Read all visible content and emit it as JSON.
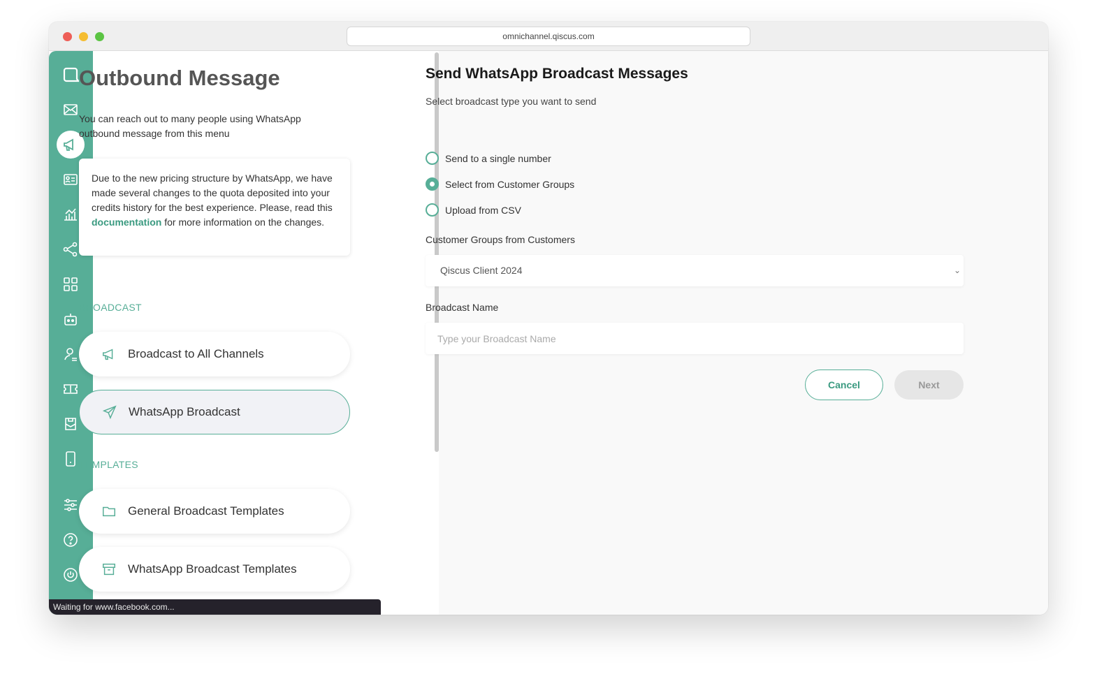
{
  "browser": {
    "url": "omnichannel.qiscus.com"
  },
  "rail": {
    "icons": [
      "chat-bubble-icon",
      "mail-icon",
      "megaphone-icon",
      "contact-card-icon",
      "analytics-chart-icon",
      "share-nodes-icon",
      "apps-grid-icon",
      "bot-icon",
      "agent-icon",
      "ticket-icon",
      "inbox-icon",
      "mobile-icon",
      "settings-sliders-icon",
      "help-icon",
      "power-icon"
    ],
    "active": "megaphone-icon",
    "color": "#57ae97"
  },
  "left": {
    "title": "Outbound Message",
    "intro": "You can reach out to many people using WhatsApp outbound message from this menu",
    "notice": {
      "before": "Due to the new pricing structure by WhatsApp, we have made several changes to the quota deposited into your credits history for the best experience. Please, read this ",
      "link": "documentation",
      "after": " for more information on the changes."
    },
    "broadcast_section": "BROADCAST",
    "broadcast_items": [
      {
        "label": "Broadcast to All Channels",
        "icon": "megaphone-icon"
      },
      {
        "label": "WhatsApp Broadcast",
        "icon": "send-icon",
        "active": true
      }
    ],
    "templates_section": "TEMPLATES",
    "template_items": [
      {
        "label": "General Broadcast Templates",
        "icon": "folder-icon"
      },
      {
        "label": "WhatsApp Broadcast Templates",
        "icon": "archive-icon"
      }
    ]
  },
  "status_bar": "Waiting for www.facebook.com...",
  "form": {
    "title": "Send WhatsApp Broadcast Messages",
    "subtitle": "Select broadcast type you want to send",
    "options": [
      {
        "label": "Send to a single number",
        "checked": false
      },
      {
        "label": "Select from Customer Groups",
        "checked": true
      },
      {
        "label": "Upload from CSV",
        "checked": false
      }
    ],
    "group_label": "Customer Groups from Customers",
    "group_value": "Qiscus Client 2024",
    "name_label": "Broadcast Name",
    "name_placeholder": "Type your Broadcast Name",
    "name_value": "",
    "cancel": "Cancel",
    "next": "Next"
  }
}
